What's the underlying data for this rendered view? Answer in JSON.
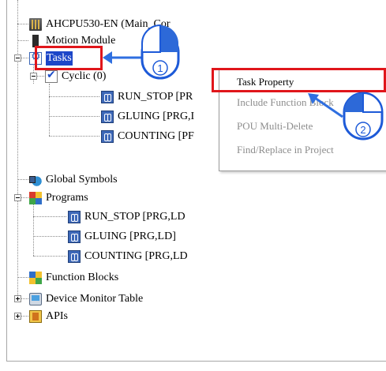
{
  "tree": {
    "items": [
      {
        "label": "AHCPU530-EN  (Main_Cor",
        "icon": "cpu-icon"
      },
      {
        "label": "Motion Module",
        "icon": "module-icon"
      },
      {
        "label": "Tasks",
        "icon": "tasks-icon"
      },
      {
        "label": "Cyclic (0)",
        "icon": "checkbox-icon"
      },
      {
        "label": "RUN_STOP [PR",
        "icon": "program-icon"
      },
      {
        "label": "GLUING [PRG,I",
        "icon": "program-icon"
      },
      {
        "label": "COUNTING [PF",
        "icon": "program-icon"
      },
      {
        "label": "Global Symbols",
        "icon": "global-symbols-icon"
      },
      {
        "label": "Programs",
        "icon": "programs-icon"
      },
      {
        "label": "RUN_STOP [PRG,LD",
        "icon": "program-icon"
      },
      {
        "label": "GLUING [PRG,LD]",
        "icon": "program-icon"
      },
      {
        "label": "COUNTING [PRG,LD",
        "icon": "program-icon"
      },
      {
        "label": "Function Blocks",
        "icon": "function-blocks-icon"
      },
      {
        "label": "Device Monitor Table",
        "icon": "device-monitor-icon"
      },
      {
        "label": "APIs",
        "icon": "apis-icon"
      }
    ]
  },
  "context_menu": {
    "items": [
      {
        "label": "Task Property",
        "enabled": true
      },
      {
        "label": "Include Function Block",
        "enabled": false
      },
      {
        "label": "POU Multi-Delete",
        "enabled": false
      },
      {
        "label": "Find/Replace in Project",
        "enabled": false
      }
    ]
  },
  "annotations": {
    "step1": "1",
    "step2": "2"
  },
  "colors": {
    "selection": "#1c46c8",
    "highlight_box": "#e0161b",
    "arrow": "#2f6fe0"
  }
}
